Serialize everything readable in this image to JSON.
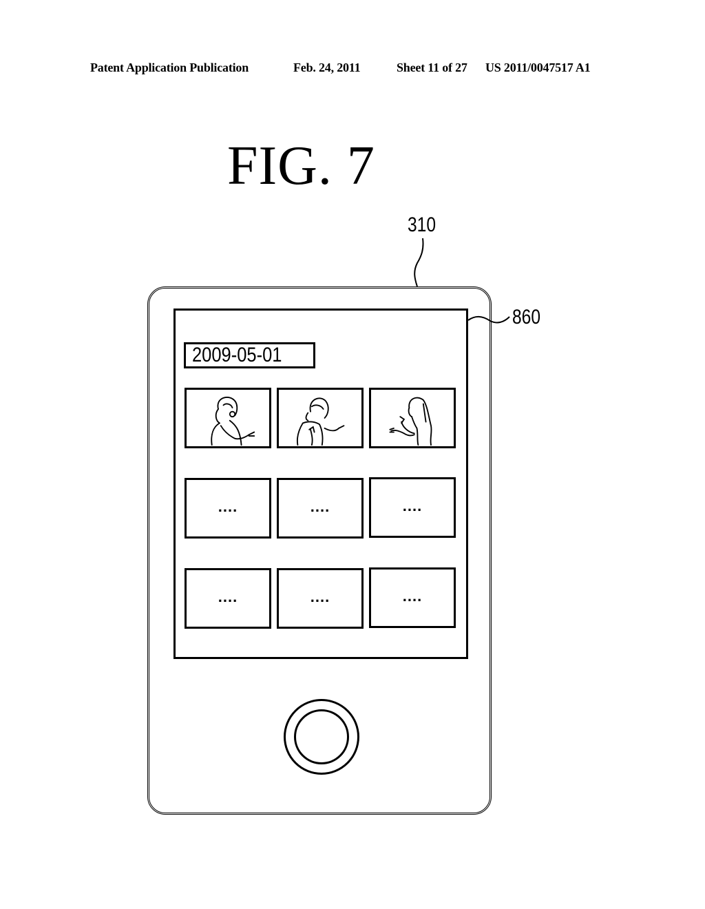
{
  "header": {
    "publication": "Patent Application Publication",
    "date": "Feb. 24, 2011",
    "sheet": "Sheet 11 of 27",
    "patent_number": "US 2011/0047517 A1"
  },
  "figure": {
    "title": "FIG.  7",
    "reference_labels": {
      "device": "310",
      "screen": "860"
    }
  },
  "screen": {
    "date_label": "2009-05-01",
    "thumbnails": [
      {
        "type": "image",
        "content": "woman-singing-with-microphone-front",
        "label": ""
      },
      {
        "type": "image",
        "content": "woman-singing-gesturing",
        "label": ""
      },
      {
        "type": "image",
        "content": "woman-singing-profile-with-microphone",
        "label": ""
      },
      {
        "type": "placeholder",
        "label": "...."
      },
      {
        "type": "placeholder",
        "label": "...."
      },
      {
        "type": "placeholder",
        "label": "...."
      },
      {
        "type": "placeholder",
        "label": "...."
      },
      {
        "type": "placeholder",
        "label": "...."
      },
      {
        "type": "placeholder",
        "label": "...."
      }
    ]
  },
  "device": {
    "home_button_icon": "circle-button-icon"
  }
}
